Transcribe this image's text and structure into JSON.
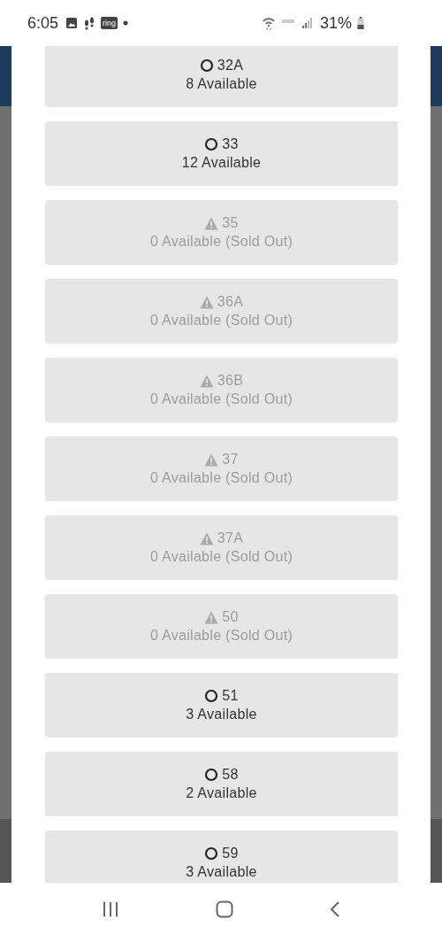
{
  "status_bar": {
    "time": "6:05",
    "ring_badge": "ring",
    "battery": "31%"
  },
  "options": [
    {
      "label": "32A",
      "availability": "8 Available",
      "sold_out": false
    },
    {
      "label": "33",
      "availability": "12 Available",
      "sold_out": false
    },
    {
      "label": "35",
      "availability": "0 Available (Sold Out)",
      "sold_out": true
    },
    {
      "label": "36A",
      "availability": "0 Available (Sold Out)",
      "sold_out": true
    },
    {
      "label": "36B",
      "availability": "0 Available (Sold Out)",
      "sold_out": true
    },
    {
      "label": "37",
      "availability": "0 Available (Sold Out)",
      "sold_out": true
    },
    {
      "label": "37A",
      "availability": "0 Available (Sold Out)",
      "sold_out": true
    },
    {
      "label": "50",
      "availability": "0 Available (Sold Out)",
      "sold_out": true
    },
    {
      "label": "51",
      "availability": "3 Available",
      "sold_out": false
    },
    {
      "label": "58",
      "availability": "2 Available",
      "sold_out": false
    },
    {
      "label": "59",
      "availability": "3 Available",
      "sold_out": false
    }
  ]
}
